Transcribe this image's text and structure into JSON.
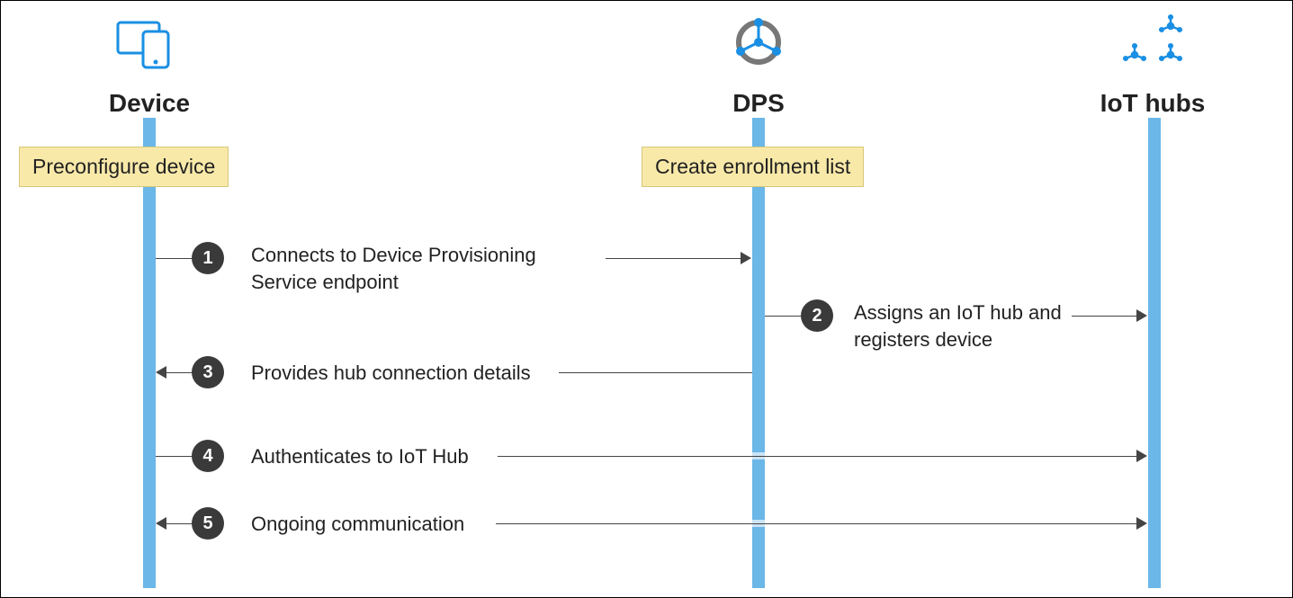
{
  "lanes": {
    "device": {
      "title": "Device",
      "box": "Preconfigure device"
    },
    "dps": {
      "title": "DPS",
      "box": "Create enrollment list"
    },
    "iothubs": {
      "title": "IoT hubs"
    }
  },
  "steps": {
    "s1": {
      "num": "1",
      "text": "Connects to Device Provisioning\nService endpoint"
    },
    "s2": {
      "num": "2",
      "text": "Assigns an IoT hub and\nregisters device"
    },
    "s3": {
      "num": "3",
      "text": "Provides hub connection details"
    },
    "s4": {
      "num": "4",
      "text": "Authenticates to IoT Hub"
    },
    "s5": {
      "num": "5",
      "text": "Ongoing communication"
    }
  },
  "colors": {
    "lifeline": "#6bb7e8",
    "box": "#f9e9a9",
    "badge": "#3a3a3a",
    "arrow": "#444444",
    "accent": "#1a8fe3"
  }
}
